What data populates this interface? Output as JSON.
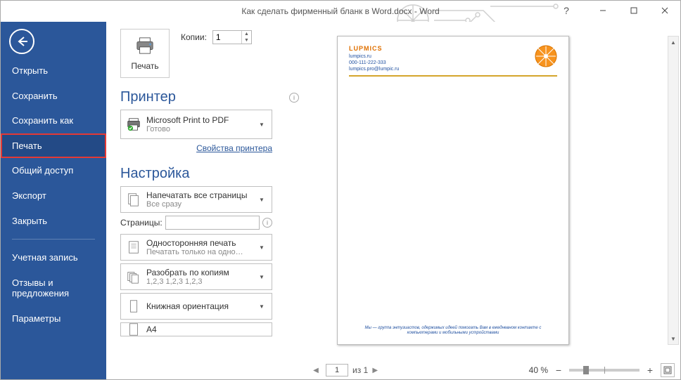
{
  "title": "Как сделать фирменный бланк в Word.docx - Word",
  "nav": {
    "items": [
      "Открыть",
      "Сохранить",
      "Сохранить как",
      "Печать",
      "Общий доступ",
      "Экспорт",
      "Закрыть"
    ],
    "items2": [
      "Учетная запись",
      "Отзывы и предложения",
      "Параметры"
    ],
    "selected": "Печать"
  },
  "print": {
    "tile_label": "Печать",
    "copies_label": "Копии:",
    "copies_value": "1",
    "printer_heading": "Принтер",
    "printer_name": "Microsoft Print to PDF",
    "printer_status": "Готово",
    "printer_props": "Свойства принтера",
    "settings_heading": "Настройка",
    "pages_all_title": "Напечатать все страницы",
    "pages_all_sub": "Все сразу",
    "pages_label": "Страницы:",
    "single_side_title": "Односторонняя печать",
    "single_side_sub": "Печатать только на одно…",
    "collate_title": "Разобрать по копиям",
    "collate_sub": "1,2,3    1,2,3    1,2,3",
    "orient_title": "Книжная ориентация",
    "paper_title": "A4"
  },
  "preview": {
    "brand": "LUPMICS",
    "site": "lumpics.ru",
    "phone": "000-111-222-333",
    "email": "lumpics.pro@lumpic.ru",
    "footer1": "Мы — группа энтузиастов, одержимых идеей помогать Вам в ежедневном контакте с",
    "footer2": "компьютерами и мобильными устройствами"
  },
  "pager": {
    "current": "1",
    "of_label": "из 1",
    "zoom": "40 %"
  }
}
